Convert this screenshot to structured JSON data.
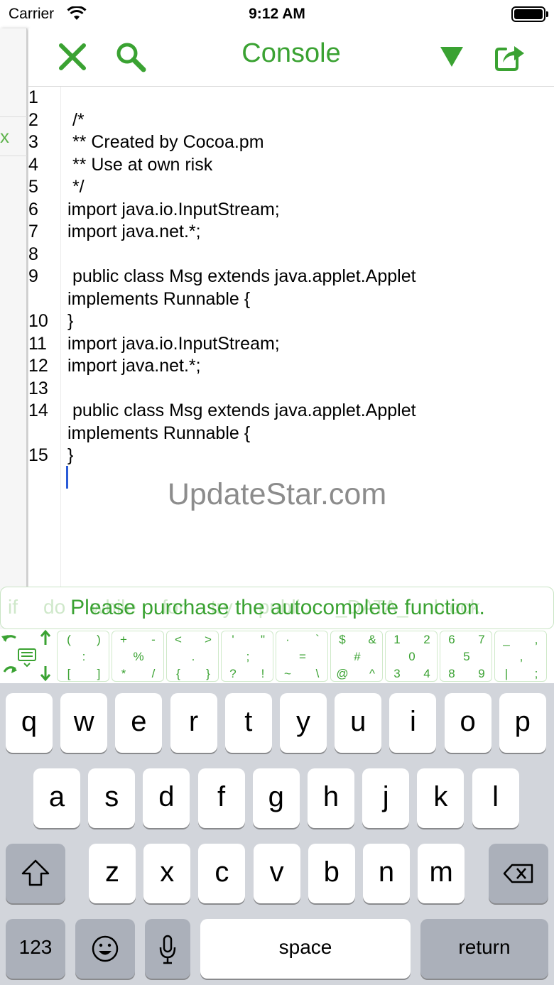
{
  "status_bar": {
    "carrier": "Carrier",
    "time": "9:12 AM"
  },
  "drawer": {
    "close_label": "x"
  },
  "navbar": {
    "title": "Console",
    "icons": [
      "close-icon",
      "search-icon",
      "dropdown-arrow-icon",
      "share-icon"
    ]
  },
  "editor": {
    "line_numbers": [
      "1",
      "2",
      "3",
      "4",
      "5",
      "6",
      "7",
      "8",
      "9",
      "",
      "10",
      "11",
      "12",
      "13",
      "14",
      "",
      "15"
    ],
    "lines": [
      "",
      " /*",
      " ** Created by Cocoa.pm",
      " ** Use at own risk",
      " */",
      "import java.io.InputStream;",
      "import java.net.*;",
      "",
      " public class Msg extends java.applet.Applet",
      "implements Runnable {",
      "}",
      "import java.io.InputStream;",
      "import java.net.*;",
      "",
      " public class Msg extends java.applet.Applet",
      "implements Runnable {",
      "}"
    ],
    "watermark": "UpdateStar.com"
  },
  "autocomplete": {
    "message": "Please purchase the autocomplete function.",
    "suggestions": [
      "if",
      "do",
      "while",
      "for",
      "try",
      "public",
      "_DATA_",
      "block"
    ]
  },
  "symbol_keys": [
    [
      "(",
      ")",
      ":",
      "[",
      "]"
    ],
    [
      "+",
      "-",
      "%",
      "*",
      "/"
    ],
    [
      "<",
      ">",
      ".",
      "{",
      "}"
    ],
    [
      "'",
      "\"",
      ";",
      "?",
      "!"
    ],
    [
      "·",
      "`",
      "=",
      "~",
      "\\"
    ],
    [
      "$",
      "&",
      "#",
      "@",
      "^"
    ],
    [
      "1",
      "2",
      "0",
      "3",
      "4"
    ],
    [
      "6",
      "7",
      "5",
      "8",
      "9"
    ],
    [
      "_",
      ",",
      ",",
      "|",
      ";"
    ]
  ],
  "keyboard": {
    "row1": [
      "q",
      "w",
      "e",
      "r",
      "t",
      "y",
      "u",
      "i",
      "o",
      "p"
    ],
    "row2": [
      "a",
      "s",
      "d",
      "f",
      "g",
      "h",
      "j",
      "k",
      "l"
    ],
    "row3": [
      "z",
      "x",
      "c",
      "v",
      "b",
      "n",
      "m"
    ],
    "numbers_label": "123",
    "space_label": "space",
    "return_label": "return"
  },
  "colors": {
    "accent_green": "#3aa232",
    "caret_blue": "#2a5bd7",
    "keyboard_bg": "#d2d5db"
  }
}
